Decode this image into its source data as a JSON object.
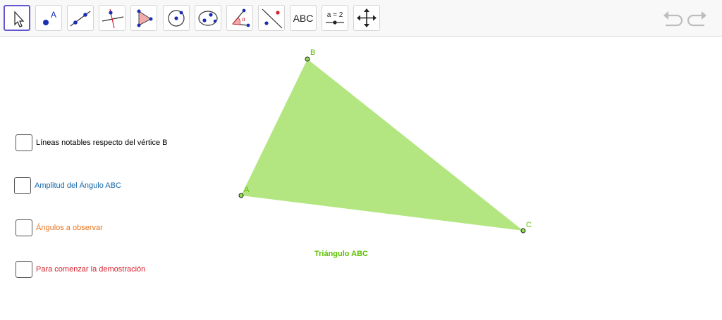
{
  "toolbar": {
    "text_tool_label": "ABC",
    "slider_tool_label": "a = 2"
  },
  "checkboxes": [
    {
      "label": "Líneas notables respecto del vértice B",
      "color": "#000000"
    },
    {
      "label": "Amplitud del Ángulo ABC",
      "color": "#1565a8"
    },
    {
      "label": "Ángulos a observar",
      "color": "#e8741e"
    },
    {
      "label": "Para comenzar la demostración",
      "color": "#d6212e"
    }
  ],
  "construction": {
    "triangle_caption": "Triángulo ABC",
    "point_labels": {
      "A": "A",
      "B": "B",
      "C": "C"
    },
    "triangle_fill": "#b3e680",
    "label_color": "#5cc000"
  }
}
